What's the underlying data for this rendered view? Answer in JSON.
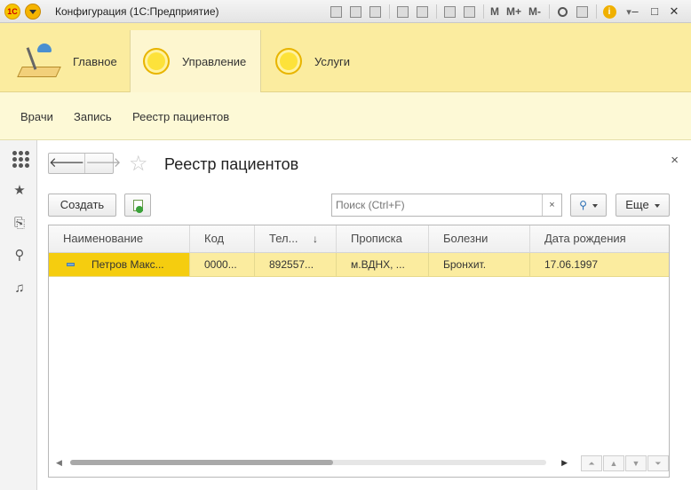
{
  "window": {
    "logo_text": "1С",
    "title": "Конфигурация (1С:Предприятие)",
    "toolbar_m_labels": [
      "M",
      "M+",
      "M-"
    ],
    "info_symbol": "i",
    "minimize": "–",
    "maximize": "□",
    "close": "✕"
  },
  "sections": [
    {
      "label": "Главное",
      "icon": "desk-lamp-icon",
      "active": false
    },
    {
      "label": "Управление",
      "icon": "yellow-circle-icon",
      "active": true
    },
    {
      "label": "Услуги",
      "icon": "yellow-circle-icon",
      "active": false
    }
  ],
  "subnav": [
    "Врачи",
    "Запись",
    "Реестр пациентов"
  ],
  "form": {
    "title": "Реестр пациентов",
    "back_symbol": "🡐",
    "forward_symbol": "🡒",
    "favorite_symbol": "☆",
    "close_symbol": "×",
    "create_label": "Создать",
    "search_placeholder": "Поиск (Ctrl+F)",
    "search_clear": "×",
    "more_label": "Еще"
  },
  "table": {
    "columns": [
      "Наименование",
      "Код",
      "Тел...",
      "Прописка",
      "Болезни",
      "Дата рождения"
    ],
    "sort_column": "Тел...",
    "sort_symbol": "↓",
    "rows": [
      [
        "Петров Макс...",
        "0000...",
        "892557...",
        "м.ВДНХ, ...",
        "Бронхит.",
        "17.06.1997"
      ]
    ]
  },
  "colors": {
    "section_bg": "#fbec9f",
    "subnav_bg": "#fdf9d6",
    "row_selected": "#fbec9f",
    "cell_focused": "#f5cd0f"
  }
}
